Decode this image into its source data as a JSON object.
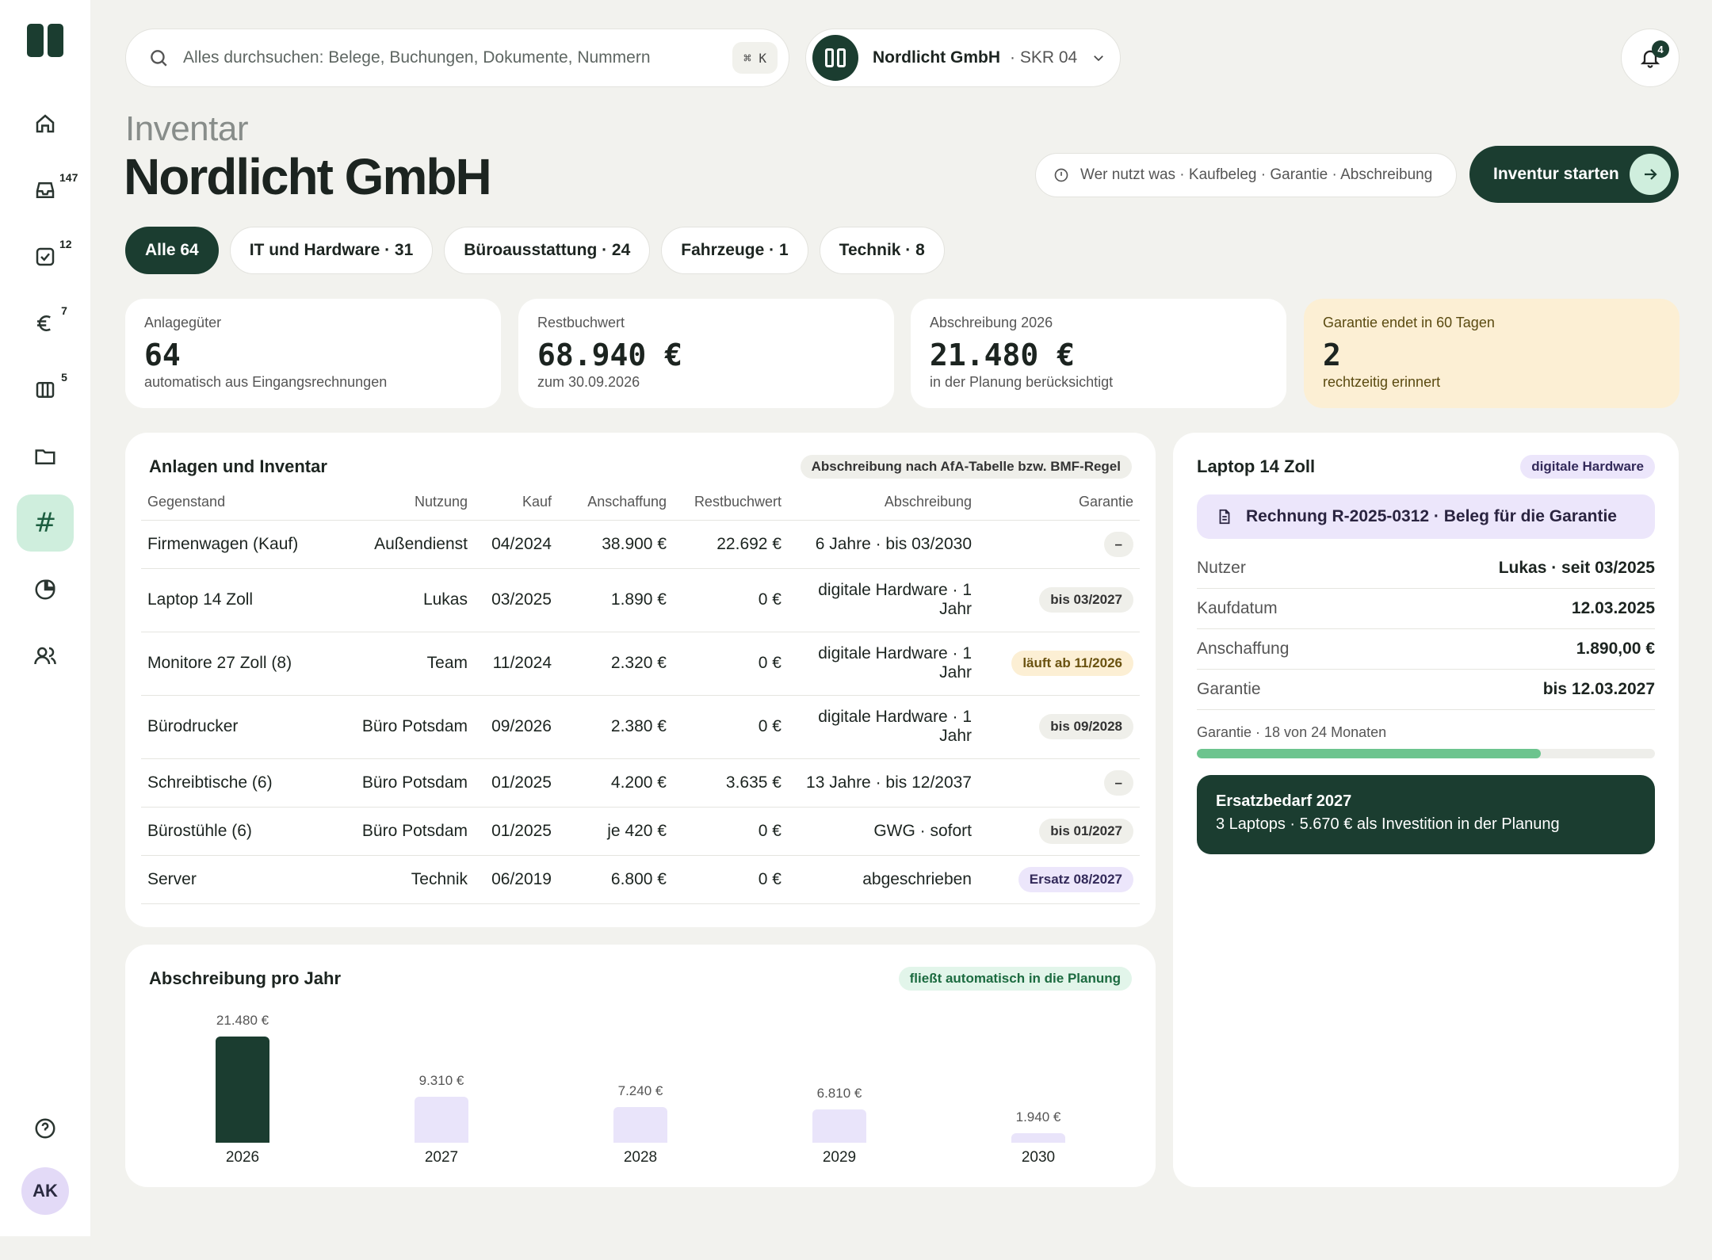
{
  "sidebar": {
    "items": [
      {
        "name": "home",
        "badge": ""
      },
      {
        "name": "inbox",
        "badge": "147"
      },
      {
        "name": "tasks",
        "badge": "12"
      },
      {
        "name": "payments",
        "badge": "7"
      },
      {
        "name": "board",
        "badge": "5"
      },
      {
        "name": "documents",
        "badge": ""
      },
      {
        "name": "inventory",
        "badge": ""
      },
      {
        "name": "reports",
        "badge": ""
      },
      {
        "name": "contacts",
        "badge": ""
      }
    ],
    "hash_glyph": "#",
    "avatar": "AK"
  },
  "search": {
    "placeholder": "Alles durchsuchen: Belege, Buchungen, Dokumente, Nummern",
    "shortcut": "⌘ K"
  },
  "company": {
    "name": "Nordlicht GmbH",
    "chart_of_accounts": "· SKR 04"
  },
  "notifications": {
    "count": "4"
  },
  "page": {
    "eyebrow": "Inventar",
    "title": "Nordlicht GmbH"
  },
  "hint": "Wer nutzt was · Kaufbeleg · Garantie · Abschreibung",
  "cta": "Inventur starten",
  "filters": [
    "Alle 64",
    "IT und Hardware · 31",
    "Büroausstattung · 24",
    "Fahrzeuge · 1",
    "Technik · 8"
  ],
  "kpis": [
    {
      "label": "Anlagegüter",
      "value": "64",
      "sub": "automatisch aus Eingangsrechnungen"
    },
    {
      "label": "Restbuchwert",
      "value": "68.940 €",
      "sub": "zum 30.09.2026"
    },
    {
      "label": "Abschreibung 2026",
      "value": "21.480 €",
      "sub": "in der Planung berücksichtigt"
    },
    {
      "label": "Garantie endet in 60 Tagen",
      "value": "2",
      "sub": "rechtzeitig erinnert"
    }
  ],
  "assets": {
    "title": "Anlagen und Inventar",
    "badge": "Abschreibung nach AfA-Tabelle bzw. BMF-Regel",
    "columns": [
      "Gegenstand",
      "Nutzung",
      "Kauf",
      "Anschaffung",
      "Restbuchwert",
      "Abschreibung",
      "Garantie"
    ],
    "rows": [
      {
        "item": "Firmenwagen (Kauf)",
        "usage": "Außendienst",
        "bought": "04/2024",
        "cost": "38.900 €",
        "book": "22.692 €",
        "depr": "6 Jahre · bis 03/2030",
        "warranty": "–",
        "wstyle": "grey"
      },
      {
        "item": "Laptop 14 Zoll",
        "usage": "Lukas",
        "bought": "03/2025",
        "cost": "1.890 €",
        "book": "0 €",
        "depr": "digitale Hardware · 1 Jahr",
        "warranty": "bis 03/2027",
        "wstyle": "grey"
      },
      {
        "item": "Monitore 27 Zoll (8)",
        "usage": "Team",
        "bought": "11/2024",
        "cost": "2.320 €",
        "book": "0 €",
        "depr": "digitale Hardware · 1 Jahr",
        "warranty": "läuft ab 11/2026",
        "wstyle": "warn"
      },
      {
        "item": "Bürodrucker",
        "usage": "Büro Potsdam",
        "bought": "09/2026",
        "cost": "2.380 €",
        "book": "0 €",
        "depr": "digitale Hardware · 1 Jahr",
        "warranty": "bis 09/2028",
        "wstyle": "grey"
      },
      {
        "item": "Schreibtische (6)",
        "usage": "Büro Potsdam",
        "bought": "01/2025",
        "cost": "4.200 €",
        "book": "3.635 €",
        "depr": "13 Jahre · bis 12/2037",
        "warranty": "–",
        "wstyle": "grey"
      },
      {
        "item": "Bürostühle (6)",
        "usage": "Büro Potsdam",
        "bought": "01/2025",
        "cost": "je 420 €",
        "book": "0 €",
        "depr": "GWG · sofort",
        "warranty": "bis 01/2027",
        "wstyle": "grey"
      },
      {
        "item": "Server",
        "usage": "Technik",
        "bought": "06/2019",
        "cost": "6.800 €",
        "book": "0 €",
        "depr": "abgeschrieben",
        "warranty": "Ersatz 08/2027",
        "wstyle": "lilac"
      }
    ]
  },
  "detail": {
    "title": "Laptop 14 Zoll",
    "badge": "digitale Hardware",
    "document": "Rechnung R-2025-0312 · Beleg für die Garantie",
    "rows": [
      {
        "k": "Nutzer",
        "v": "Lukas · seit 03/2025"
      },
      {
        "k": "Kaufdatum",
        "v": "12.03.2025"
      },
      {
        "k": "Anschaffung",
        "v": "1.890,00 €"
      },
      {
        "k": "Garantie",
        "v": "bis 12.03.2027"
      }
    ],
    "warranty_progress_label": "Garantie · 18 von 24 Monaten",
    "warranty_progress": 0.75,
    "replacement_title": "Ersatzbedarf 2027",
    "replacement_text": "3 Laptops · 5.670 € als Investition in der Planung"
  },
  "chart_data": {
    "type": "bar",
    "title": "Abschreibung pro Jahr",
    "badge": "fließt automatisch in die Planung",
    "categories": [
      "2026",
      "2027",
      "2028",
      "2029",
      "2030"
    ],
    "values": [
      21480,
      9310,
      7240,
      6810,
      1940
    ],
    "value_labels": [
      "21.480 €",
      "9.310 €",
      "7.240 €",
      "6.810 €",
      "1.940 €"
    ],
    "colors": [
      "#1b3d30",
      "#e9e4fa",
      "#e9e4fa",
      "#e9e4fa",
      "#e9e4fa"
    ],
    "ylim": [
      0,
      21480
    ]
  }
}
